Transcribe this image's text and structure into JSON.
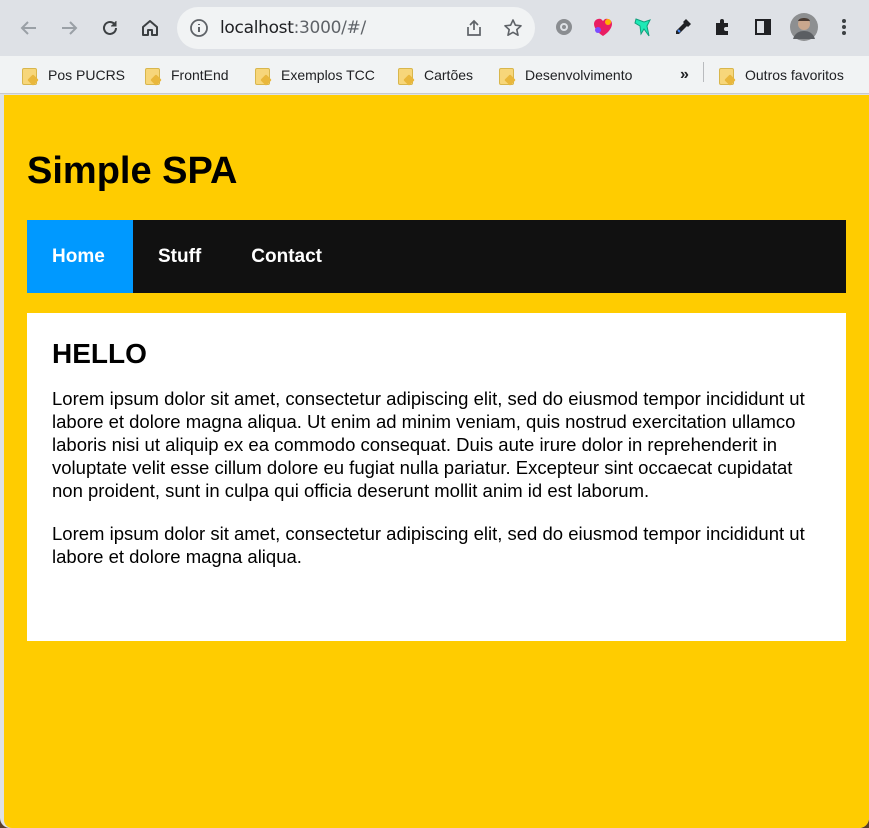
{
  "browser": {
    "url_host": "localhost",
    "url_rest": ":3000/#/",
    "bookmarks": [
      "Pos PUCRS",
      "FrontEnd",
      "Exemplos TCC",
      "Cartões",
      "Desenvolvimento"
    ],
    "more_bookmarks": "»",
    "other_bookmarks": "Outros favoritos"
  },
  "page": {
    "title": "Simple SPA",
    "menu": [
      "Home",
      "Stuff",
      "Contact"
    ],
    "active_menu": "Home",
    "content": {
      "heading": "HELLO",
      "paragraphs": [
        "Lorem ipsum dolor sit amet, consectetur adipiscing elit, sed do eiusmod tempor incididunt ut labore et dolore magna aliqua. Ut enim ad minim veniam, quis nostrud exercitation ullamco laboris nisi ut aliquip ex ea commodo consequat. Duis aute irure dolor in reprehenderit in voluptate velit esse cillum dolore eu fugiat nulla pariatur. Excepteur sint occaecat cupidatat non proident, sunt in culpa qui officia deserunt mollit anim id est laborum.",
        "Lorem ipsum dolor sit amet, consectetur adipiscing elit, sed do eiusmod tempor incididunt ut labore et dolore magna aliqua."
      ]
    }
  },
  "colors": {
    "page_background": "#ffcc00",
    "menu_background": "#111111",
    "menu_active": "#0099ff",
    "content_background": "#ffffff"
  }
}
